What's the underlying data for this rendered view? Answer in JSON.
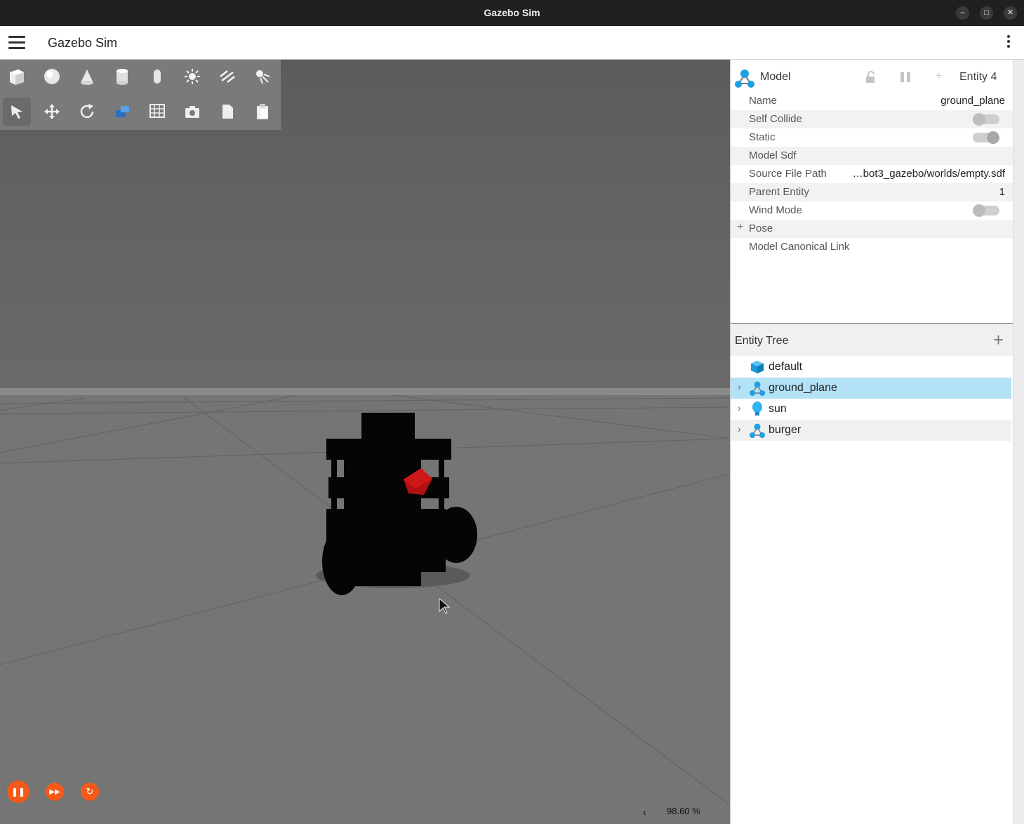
{
  "window": {
    "title": "Gazebo Sim"
  },
  "appbar": {
    "title": "Gazebo Sim"
  },
  "toolbar": {
    "row1": [
      "box-icon",
      "sphere-icon",
      "cone-icon",
      "cylinder-icon",
      "capsule-icon",
      "sun-light-icon",
      "directional-light-icon",
      "spot-light-icon"
    ],
    "row2": [
      "select-icon",
      "translate-icon",
      "rotate-icon",
      "transform-control-icon",
      "grid-snap-icon",
      "screenshot-icon",
      "copy-icon",
      "paste-icon"
    ]
  },
  "playback": {
    "real_time_factor": "98.60 %"
  },
  "component_inspector": {
    "type_label": "Model",
    "entity_label": "Entity 4",
    "properties": [
      {
        "key": "Name",
        "value": "ground_plane"
      },
      {
        "key": "Self Collide",
        "toggle": false
      },
      {
        "key": "Static",
        "toggle": true
      },
      {
        "key": "Model Sdf",
        "value": ""
      },
      {
        "key": "Source File Path",
        "value": "…bot3_gazebo/worlds/empty.sdf"
      },
      {
        "key": "Parent Entity",
        "value": "1"
      },
      {
        "key": "Wind Mode",
        "toggle": false
      },
      {
        "key": "Pose",
        "value": ""
      },
      {
        "key": "Model Canonical Link",
        "value": ""
      }
    ]
  },
  "entity_tree": {
    "title": "Entity Tree",
    "items": [
      {
        "name": "default",
        "icon": "world-icon",
        "expandable": false,
        "selected": false
      },
      {
        "name": "ground_plane",
        "icon": "model-icon",
        "expandable": true,
        "selected": true
      },
      {
        "name": "sun",
        "icon": "light-icon",
        "expandable": true,
        "selected": false
      },
      {
        "name": "burger",
        "icon": "model-icon",
        "expandable": true,
        "selected": false
      }
    ]
  }
}
